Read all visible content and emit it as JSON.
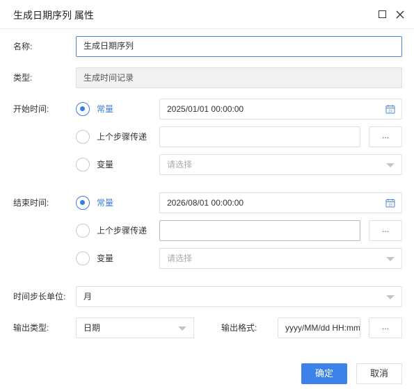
{
  "dialog": {
    "title": "生成日期序列 属性"
  },
  "form": {
    "name_label": "名称:",
    "name_value": "生成日期序列",
    "type_label": "类型:",
    "type_value": "生成时间记录",
    "start": {
      "label": "开始时间:",
      "options": [
        "常量",
        "上个步骤传递",
        "变量"
      ],
      "selected": "常量",
      "constant_value": "2025/01/01 00:00:00",
      "prev_step_value": "",
      "variable_placeholder": "请选择",
      "dots": "..."
    },
    "end": {
      "label": "结束时间:",
      "options": [
        "常量",
        "上个步骤传递",
        "变量"
      ],
      "selected": "常量",
      "constant_value": "2026/08/01 00:00:00",
      "prev_step_value": "",
      "variable_placeholder": "请选择",
      "dots": "..."
    },
    "step_unit_label": "时间步长单位:",
    "step_unit_value": "月",
    "output_type_label": "输出类型:",
    "output_type_value": "日期",
    "output_format_label": "输出格式:",
    "output_format_value": "yyyy/MM/dd HH:mm",
    "output_format_dots": "..."
  },
  "buttons": {
    "ok": "确定",
    "cancel": "取消"
  },
  "colors": {
    "accent": "#3c7ddb",
    "primary_button": "#3c82e8",
    "border": "#dcdfe6",
    "disabled_bg": "#f2f2f2"
  },
  "icons": [
    "maximize-icon",
    "close-icon",
    "calendar-icon",
    "chevron-down-icon"
  ]
}
